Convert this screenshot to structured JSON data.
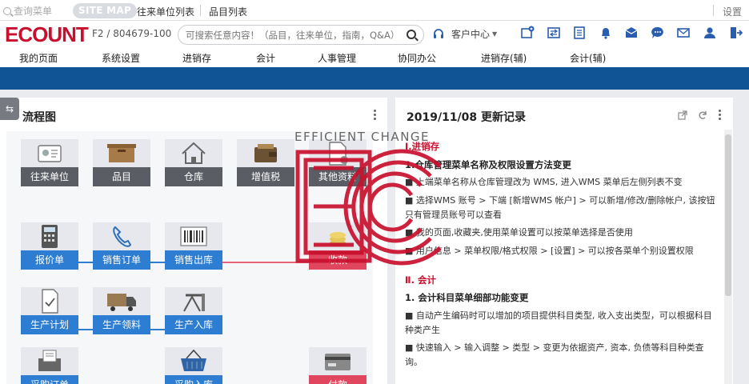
{
  "topbar": {
    "quick_search": "查询菜单",
    "sitemap": "SITE MAP",
    "links": [
      "往来单位列表",
      "品目列表"
    ],
    "settings": "设置"
  },
  "header": {
    "logo": "ECOUNT",
    "company": "F2 / 804679-100",
    "search_placeholder": "可搜索任意内容！（品目，往来单位，指南，Q&A）",
    "customer_center": "客户中心"
  },
  "menu": [
    "我的页面",
    "系统设置",
    "进销存",
    "会计",
    "人事管理",
    "协同办公",
    "进销存(辅)",
    "会计(辅)"
  ],
  "flow": {
    "title": "流程图",
    "nodes": {
      "partner": "往来单位",
      "item": "品目",
      "warehouse": "仓库",
      "vat": "增值税",
      "other": "其他资料",
      "quotation": "报价单",
      "sales_order": "销售订单",
      "sales_out": "销售出库",
      "collection": "收款",
      "prod_plan": "生产计划",
      "prod_issue": "生产领料",
      "prod_in": "生产入库",
      "purchase_order": "采购订单",
      "purchase_in": "采购入库",
      "payment": "付款"
    }
  },
  "notes": {
    "title": "2019/11/08 更新记录",
    "watermark": "EFFICIENT CHANGE",
    "lines": [
      "Ⅰ.进销存",
      "1.仓库管理菜单名称及权限设置方法变更",
      "■ 上端菜单名称从仓库管理改为 WMS, 进入WMS 菜单后左侧列表不变",
      "■ 选择WMS 账号 > 下端 [新增WMS 帐户] > 可以新增/修改/删除帐户, 该按钮只有管理员账号可以查看",
      "■ 我的页面,收藏夹,使用菜单设置可以按菜单选择是否使用",
      "■ 用户信息 > 菜单权限/格式权限 > [设置] > 可以按各菜单个别设置权限",
      "Ⅱ. 会计",
      "1. 会计科目菜单细部功能变更",
      "■ 自动产生编码时可以增加的项目提供科目类型, 收入支出类型，可以根据科目种类产生",
      "■ 快速输入 > 输入调整 > 类型 > 变更为依据资产, 资本, 负债等科目种类查询。"
    ]
  },
  "colors": {
    "brand_red": "#c8102e",
    "nav_blue": "#115496",
    "flow_blue": "#2d7dd2",
    "flow_red": "#e0475f",
    "flow_gray": "#5a5d63"
  }
}
